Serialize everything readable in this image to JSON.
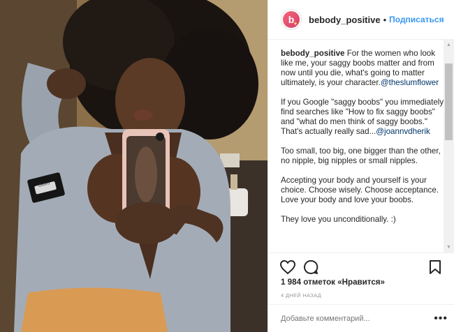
{
  "post": {
    "username": "bebody_positive",
    "separator": "•",
    "follow_label": "Подписаться",
    "avatar_letter": "b",
    "caption": {
      "username": "bebody_positive",
      "paragraphs": [
        {
          "text": " For the women who look like me, your saggy boobs matter and from now until you die, what's going to matter ultimately, is your character.",
          "mention": "@theslumflower"
        },
        {
          "text": "If you Google \"saggy boobs\" you immediately find searches like \"How to fix saggy boobs\" and \"what do men think of saggy boobs.\" That's actually really sad...",
          "mention": "@joannvdherik"
        },
        {
          "text": "Too small, too big, one bigger than the other, no nipple, big nipples or small nipples.",
          "mention": ""
        },
        {
          "text": "Accepting your body and yourself is your choice. Choose wisely. Choose acceptance. Love your body and love your boobs.",
          "mention": ""
        },
        {
          "text": "They love you unconditionally. :)",
          "mention": ""
        }
      ]
    },
    "likes_text": "1 984 отметок «Нравится»",
    "time_ago": "4 ДНЕЙ НАЗАД",
    "comment_placeholder": "Добавьте комментарий...",
    "more_label": "•••",
    "badge_text": "Ottoro",
    "icons": {
      "like": "heart-icon",
      "comment": "comment-icon",
      "save": "bookmark-icon",
      "more": "more-options-icon"
    },
    "colors": {
      "follow": "#3897f0",
      "mention": "#003569",
      "avatar": "#e8506e"
    }
  }
}
